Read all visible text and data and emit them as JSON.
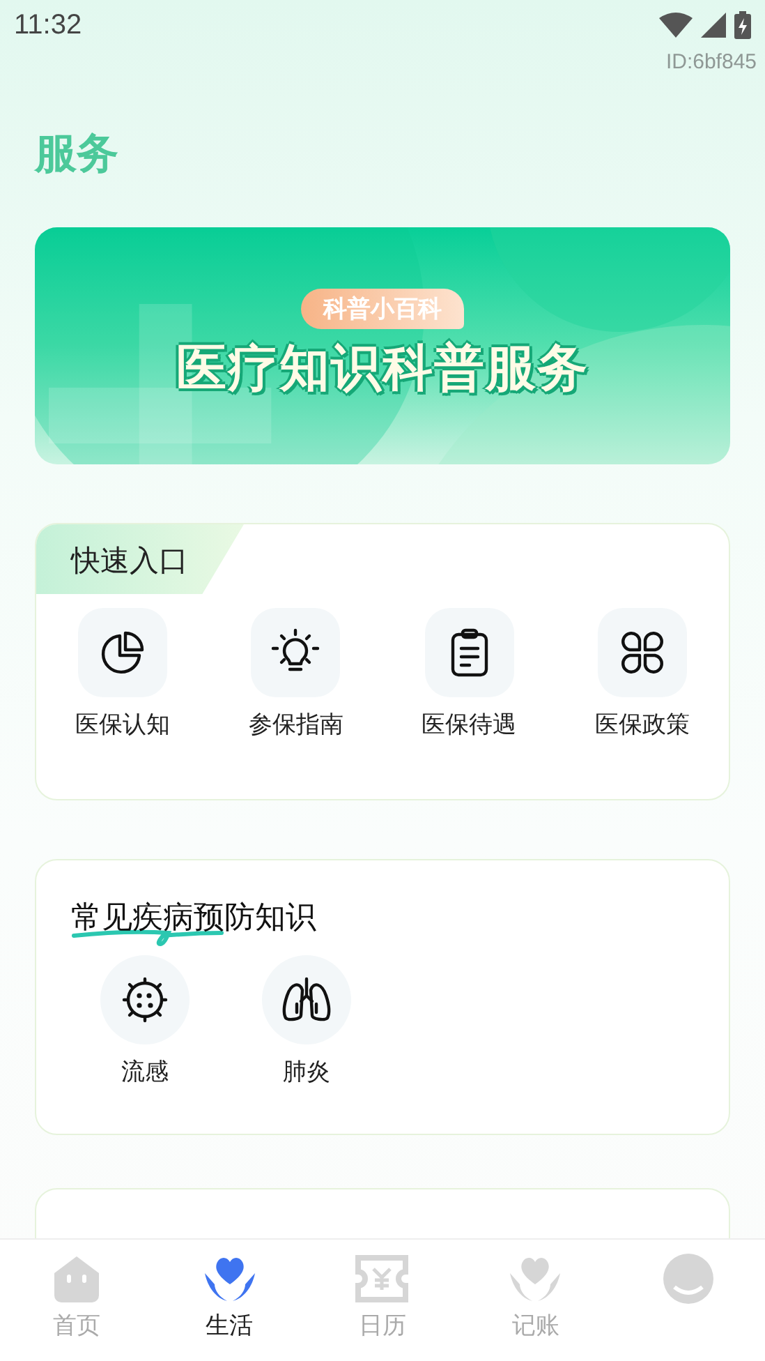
{
  "status_bar": {
    "time": "11:32"
  },
  "user_id": "ID:6bf845",
  "page_title": "服务",
  "banner": {
    "tag": "科普小百科",
    "title": "医疗知识科普服务"
  },
  "quick_entry": {
    "title": "快速入口",
    "items": [
      {
        "label": "医保认知",
        "kind": "pie"
      },
      {
        "label": "参保指南",
        "kind": "bulb"
      },
      {
        "label": "医保待遇",
        "kind": "clipboard"
      },
      {
        "label": "医保政策",
        "kind": "petals"
      }
    ]
  },
  "disease_section": {
    "title": "常见疾病预防知识",
    "items": [
      {
        "label": "流感",
        "kind": "virus"
      },
      {
        "label": "肺炎",
        "kind": "lungs"
      }
    ]
  },
  "tab_bar": [
    {
      "label": "首页",
      "kind": "home",
      "selected": false
    },
    {
      "label": "生活",
      "kind": "care",
      "selected": true
    },
    {
      "label": "日历",
      "kind": "ticket",
      "selected": false
    },
    {
      "label": "记账",
      "kind": "care",
      "selected": false
    },
    {
      "kind": "face",
      "selected": false
    }
  ]
}
